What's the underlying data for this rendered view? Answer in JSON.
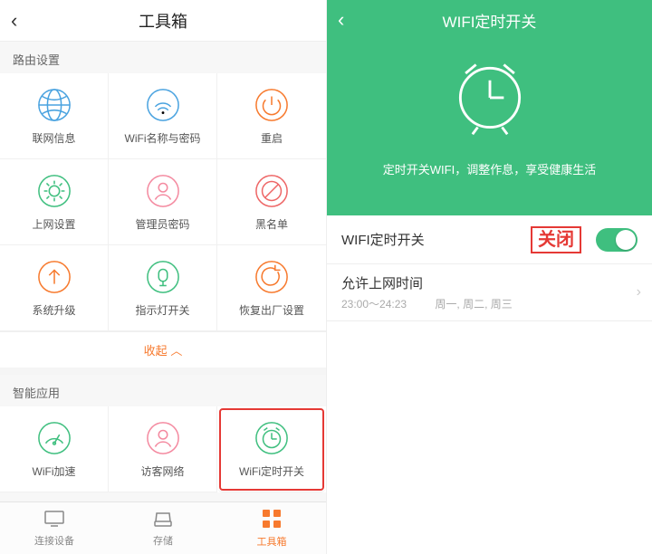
{
  "left": {
    "title": "工具箱",
    "back_glyph": "‹",
    "sections": {
      "router": {
        "label": "路由设置",
        "items": [
          {
            "name": "globe-icon",
            "label": "联网信息",
            "color": "c-blue"
          },
          {
            "name": "wifi-icon",
            "label": "WiFi名称与密码",
            "color": "c-blue"
          },
          {
            "name": "power-icon",
            "label": "重启",
            "color": "c-orange"
          },
          {
            "name": "gear-icon",
            "label": "上网设置",
            "color": "c-green"
          },
          {
            "name": "user-icon",
            "label": "管理员密码",
            "color": "c-pink"
          },
          {
            "name": "ban-icon",
            "label": "黑名单",
            "color": "c-red"
          },
          {
            "name": "upgrade-icon",
            "label": "系统升级",
            "color": "c-orange"
          },
          {
            "name": "led-icon",
            "label": "指示灯开关",
            "color": "c-green"
          },
          {
            "name": "reset-icon",
            "label": "恢复出厂设置",
            "color": "c-orange"
          }
        ]
      },
      "collapse_label": "收起",
      "smart": {
        "label": "智能应用",
        "items": [
          {
            "name": "speed-icon",
            "label": "WiFi加速",
            "color": "c-green",
            "highlight": false
          },
          {
            "name": "guest-icon",
            "label": "访客网络",
            "color": "c-pink",
            "highlight": false
          },
          {
            "name": "clock-icon",
            "label": "WiFi定时开关",
            "color": "c-green",
            "highlight": true
          }
        ]
      }
    },
    "tabs": [
      {
        "name": "tab-devices",
        "label": "连接设备",
        "icon": "monitor-icon",
        "active": false
      },
      {
        "name": "tab-storage",
        "label": "存储",
        "icon": "disk-icon",
        "active": false
      },
      {
        "name": "tab-toolbox",
        "label": "工具箱",
        "icon": "grid-icon",
        "active": true
      }
    ]
  },
  "right": {
    "title": "WIFI定时开关",
    "back_glyph": "‹",
    "hero_desc": "定时开关WIFI，调整作息，享受健康生活",
    "switch": {
      "label": "WIFI定时开关",
      "status_text": "关闭",
      "on": true
    },
    "schedule": {
      "label": "允许上网时间",
      "time": "23:00～24:23",
      "days": "周一, 周二, 周三",
      "chevron": "›"
    }
  }
}
